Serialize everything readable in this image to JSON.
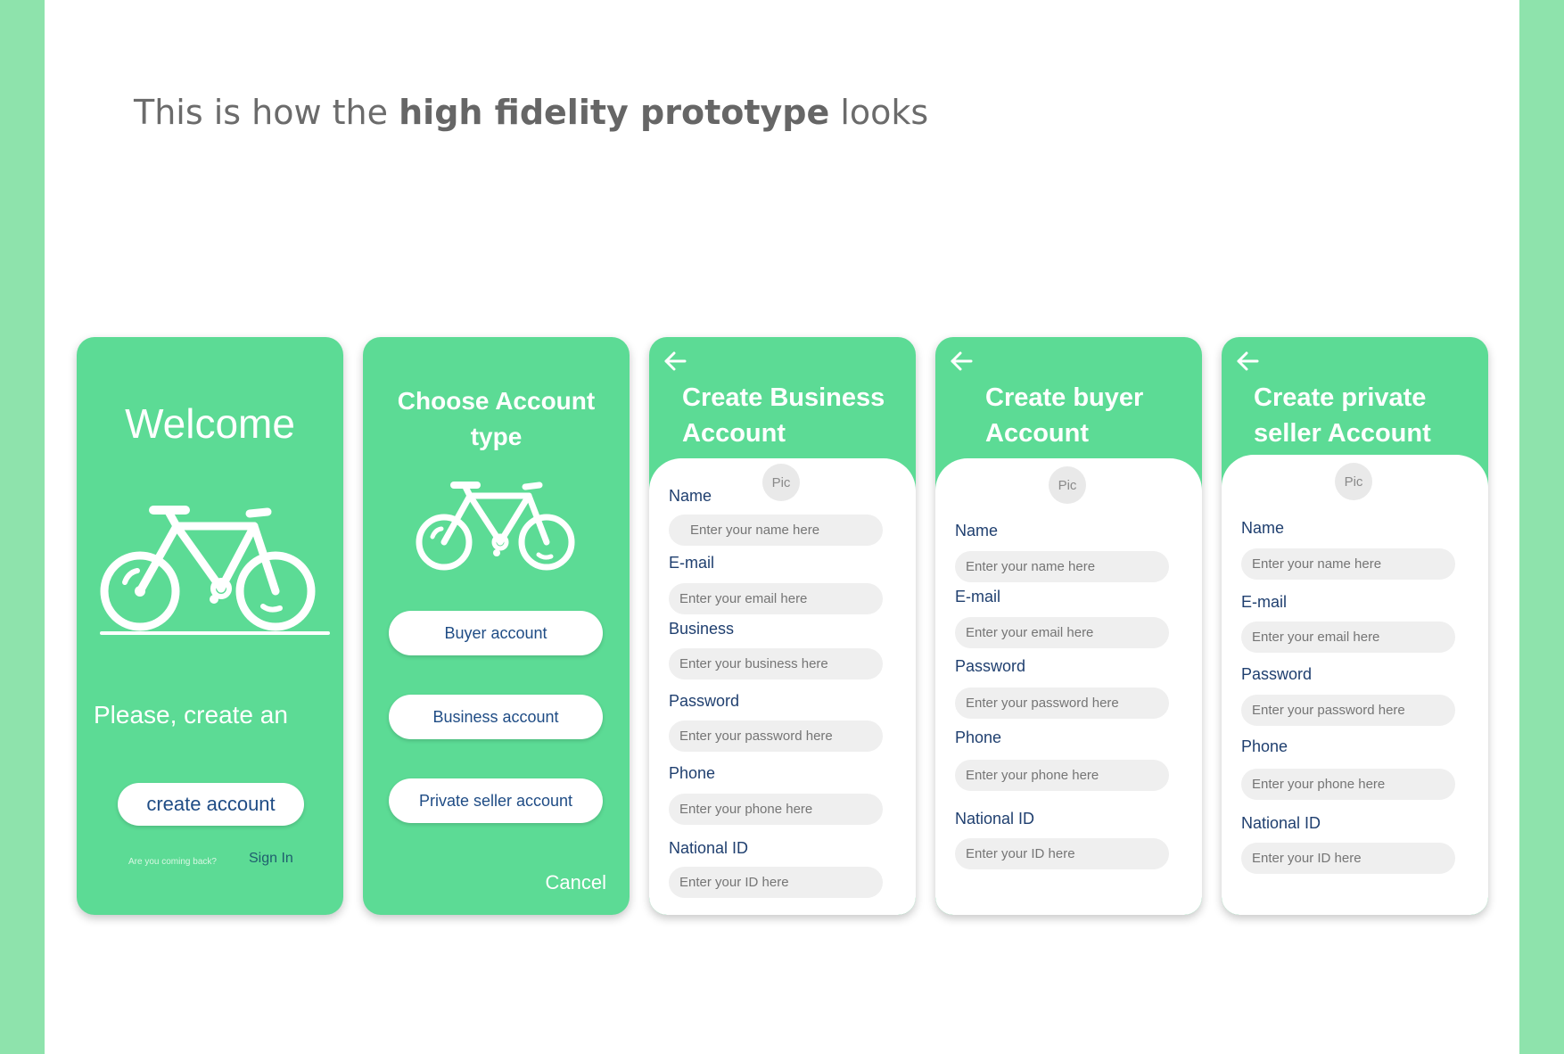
{
  "colors": {
    "green": "#5cdb95",
    "side": "#8ee3ac",
    "label": "#1f3f6f"
  },
  "headline": {
    "pre": "This is how the ",
    "bold": "high fidelity prototype",
    "post": " looks"
  },
  "welcome": {
    "title": "Welcome",
    "bike_icon": "bicycle-icon",
    "subtitle": "Please, create an",
    "create_button": "create account",
    "coming_back": "Are you coming back?",
    "sign_in": "Sign In"
  },
  "choose": {
    "title": "Choose Account type",
    "bike_icon": "bicycle-icon",
    "buttons": [
      "Buyer account",
      "Business account",
      "Private seller account"
    ],
    "cancel": "Cancel"
  },
  "business": {
    "back_icon": "arrow-left-icon",
    "title_line1": "Create Business",
    "title_line2": "Account",
    "pic": "Pic",
    "fields": [
      {
        "label": "Name",
        "placeholder": "Enter your name here"
      },
      {
        "label": "E-mail",
        "placeholder": "Enter your email here"
      },
      {
        "label": "Business",
        "placeholder": "Enter your business here"
      },
      {
        "label": "Password",
        "placeholder": "Enter your password here"
      },
      {
        "label": "Phone",
        "placeholder": "Enter your phone here"
      },
      {
        "label": "National ID",
        "placeholder": "Enter your ID here"
      }
    ]
  },
  "buyer": {
    "back_icon": "arrow-left-icon",
    "title_line1": "Create buyer",
    "title_line2": "Account",
    "pic": "Pic",
    "fields": [
      {
        "label": "Name",
        "placeholder": "Enter your name here"
      },
      {
        "label": "E-mail",
        "placeholder": "Enter your email here"
      },
      {
        "label": "Password",
        "placeholder": "Enter your password here"
      },
      {
        "label": "Phone",
        "placeholder": "Enter your phone here"
      },
      {
        "label": "National ID",
        "placeholder": "Enter your ID here"
      }
    ]
  },
  "private": {
    "back_icon": "arrow-left-icon",
    "title_line1": "Create private",
    "title_line2": "seller Account",
    "pic": "Pic",
    "fields": [
      {
        "label": "Name",
        "placeholder": "Enter your name here"
      },
      {
        "label": "E-mail",
        "placeholder": "Enter your email here"
      },
      {
        "label": "Password",
        "placeholder": "Enter your password here"
      },
      {
        "label": "Phone",
        "placeholder": "Enter your phone here"
      },
      {
        "label": "National ID",
        "placeholder": "Enter your ID here"
      }
    ]
  }
}
